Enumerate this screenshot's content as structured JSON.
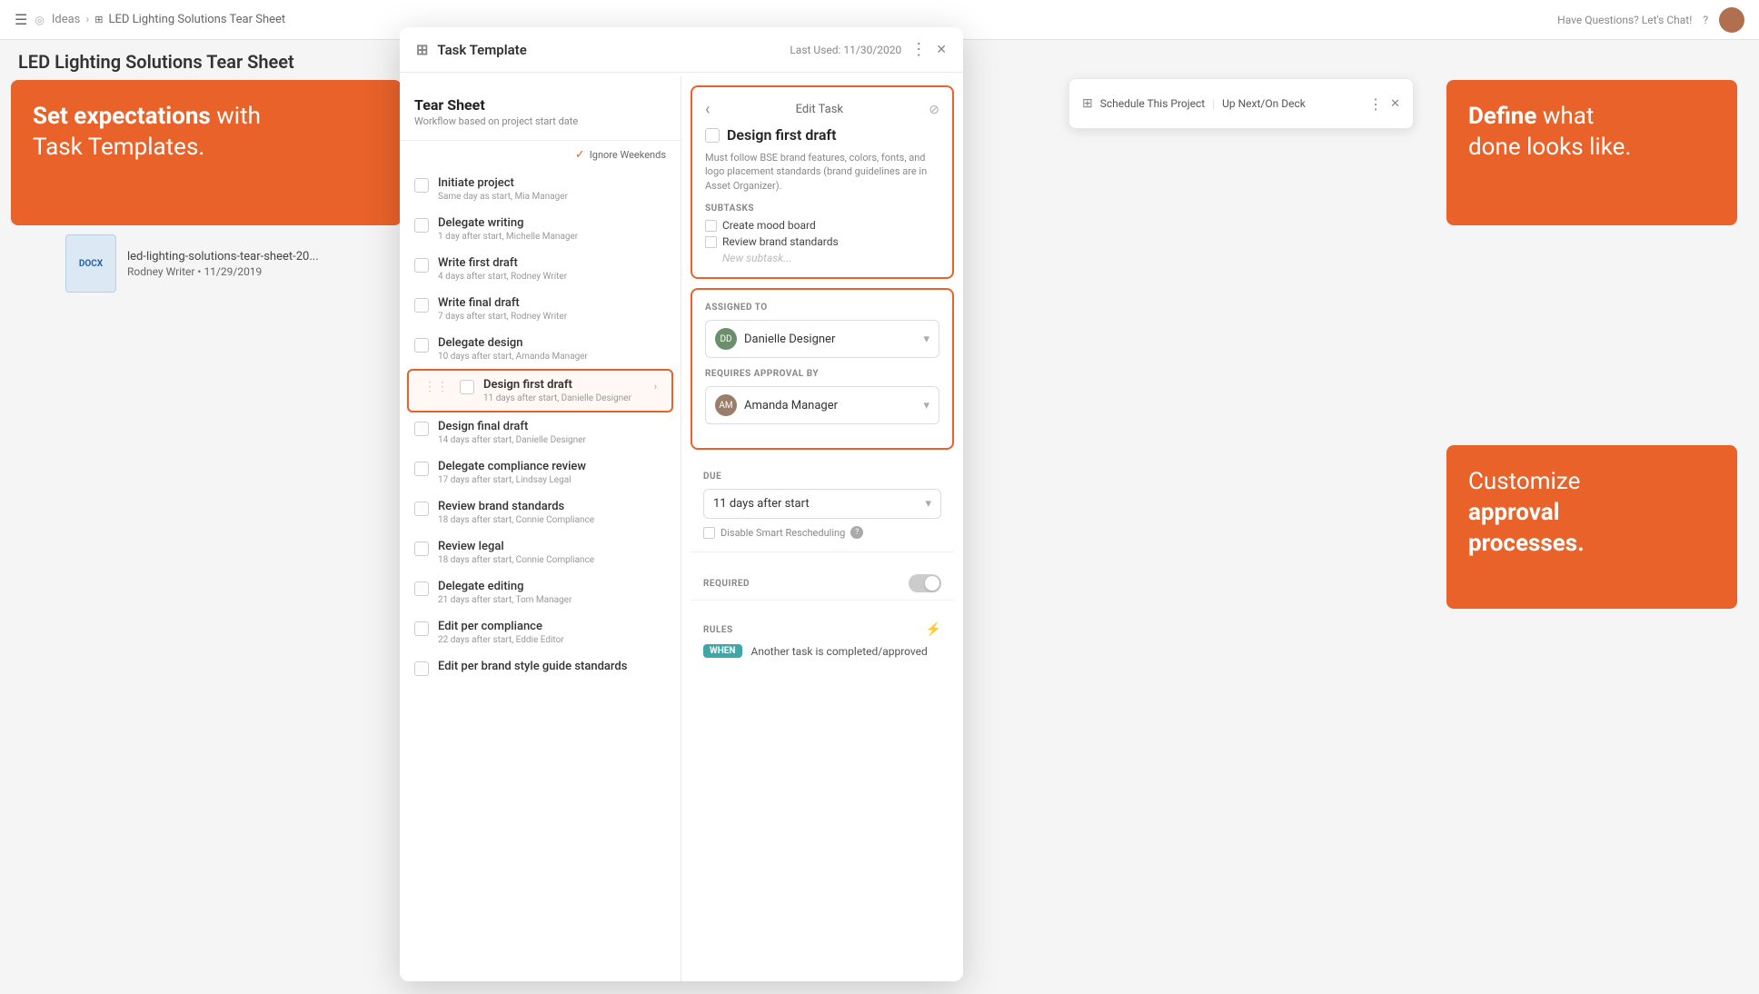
{
  "nav": {
    "hamburger": "☰",
    "location_icon": "◎",
    "breadcrumb": [
      "Ideas",
      "LED Lighting Solutions Tear Sheet"
    ],
    "help_icon": "?",
    "chat_text": "Have Questions? Let's Chat!",
    "separator": "›"
  },
  "page": {
    "title": "LED Lighting Solutions Tear Sheet"
  },
  "promo": {
    "set_main": "Set expectations",
    "set_sub": " with\nTask Templates.",
    "define_main": "Define",
    "define_sub": " what\ndone looks like.",
    "customize_main": "Customize\n",
    "customize_sub": "approval\nprocesses."
  },
  "file": {
    "type": "DOCX",
    "name": "led-lighting-solutions-tear-sheet-20...",
    "meta": "Rodney Writer • 11/29/2019"
  },
  "modal": {
    "header_icon": "⊞",
    "title": "Task Template",
    "last_used": "Last Used: 11/30/2020",
    "more_icon": "⋮",
    "close_icon": "✕"
  },
  "template": {
    "title": "Tear Sheet",
    "subtitle": "Workflow based on project start date",
    "ignore_weekends_label": "Ignore Weekends"
  },
  "tasks": [
    {
      "name": "Initiate project",
      "meta": "Same day as start,  Mia Manager"
    },
    {
      "name": "Delegate writing",
      "meta": "1 day after start,  Michelle Manager"
    },
    {
      "name": "Write first draft",
      "meta": "4 days after start,  Rodney Writer"
    },
    {
      "name": "Write final draft",
      "meta": "7 days after start,  Rodney Writer"
    },
    {
      "name": "Delegate design",
      "meta": "10 days after start,  Amanda Manager"
    },
    {
      "name": "Design first draft",
      "meta": "11 days after start,  Danielle Designer",
      "active": true
    },
    {
      "name": "Design final draft",
      "meta": "14 days after start,  Danielle Designer"
    },
    {
      "name": "Delegate compliance review",
      "meta": "17 days after start,  Lindsay Legal"
    },
    {
      "name": "Review brand standards",
      "meta": "18 days after start,  Connie Compliance"
    },
    {
      "name": "Review legal",
      "meta": "18 days after start,  Connie Compliance"
    },
    {
      "name": "Delegate editing",
      "meta": "21 days after start,  Tom Manager"
    },
    {
      "name": "Edit per compliance",
      "meta": "22 days after start,  Eddie Editor"
    },
    {
      "name": "Edit per brand style guide standards",
      "meta": ""
    }
  ],
  "edit_task": {
    "back_icon": "‹",
    "header_label": "Edit Task",
    "close_icon": "⊘",
    "task_name": "Design first draft",
    "description": "Must follow BSE brand features, colors, fonts, and logo placement standards (brand guidelines are in Asset Organizer).",
    "subtasks_label": "SUBTASKS",
    "subtasks": [
      "Create mood board",
      "Review brand standards"
    ],
    "new_subtask_placeholder": "New subtask..."
  },
  "assigned": {
    "label": "ASSIGNED TO",
    "assignee_name": "Danielle Designer",
    "approval_label": "REQUIRES APPROVAL BY",
    "approver_name": "Amanda Manager"
  },
  "due": {
    "label": "DUE",
    "value": "11 days after start",
    "disable_label": "Disable Smart Rescheduling"
  },
  "required": {
    "label": "REQUIRED"
  },
  "rules": {
    "label": "RULES",
    "when_label": "WHEN",
    "condition": "Another task is completed/approved"
  },
  "second_modal": {
    "icon": "⊞",
    "tab1": "Schedule This Project",
    "tab2": "Up Next/On Deck",
    "more": "⋮",
    "close": "✕"
  }
}
